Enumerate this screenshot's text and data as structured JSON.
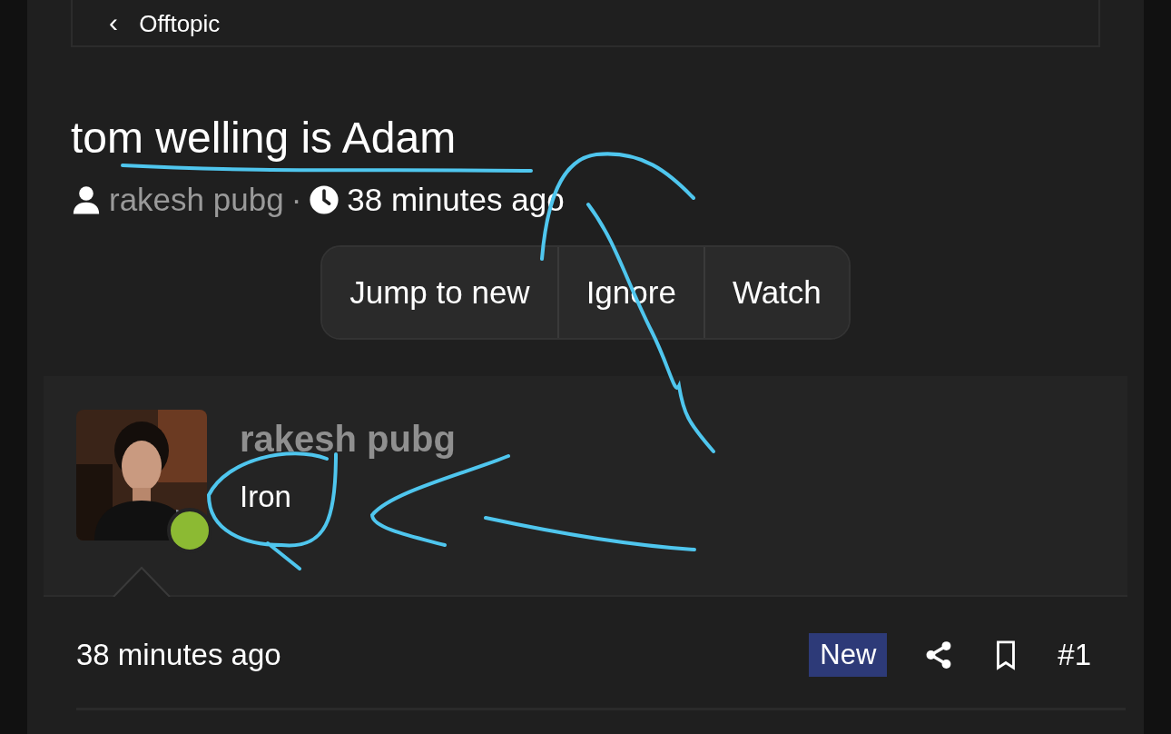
{
  "breadcrumb": {
    "back_icon": "‹",
    "label": "Offtopic"
  },
  "thread": {
    "title": "tom welling is Adam",
    "author": "rakesh pubg",
    "separator": "·",
    "time": "38 minutes ago"
  },
  "thread_actions": [
    "Jump to new",
    "Ignore",
    "Watch"
  ],
  "post": {
    "author": "rakesh pubg",
    "user_title": "Iron",
    "online": true,
    "time": "38 minutes ago",
    "badge": "New",
    "number": "#1"
  }
}
